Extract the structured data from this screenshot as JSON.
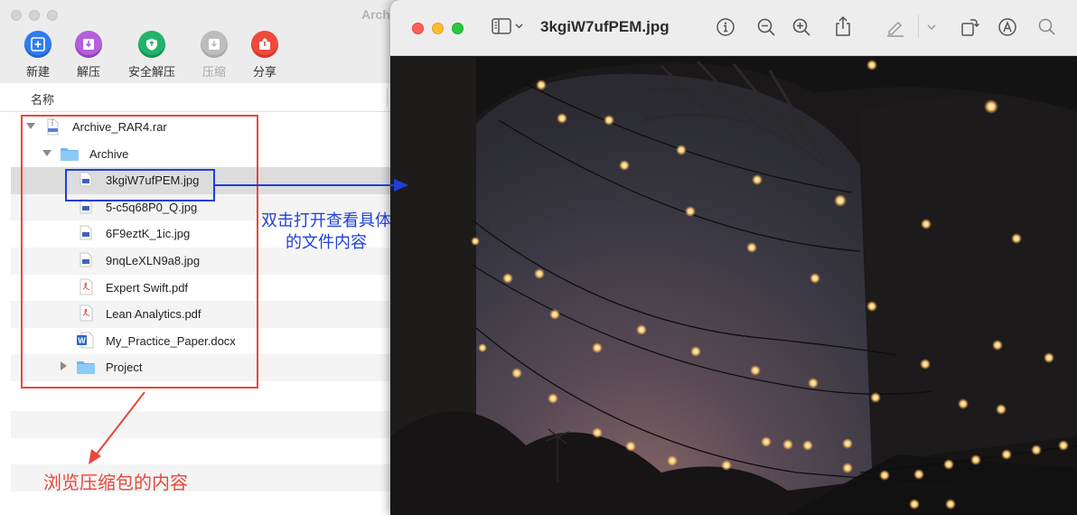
{
  "archiver": {
    "title": "Archiver",
    "toolbar": [
      {
        "id": "new",
        "label": "新建"
      },
      {
        "id": "extract",
        "label": "解压"
      },
      {
        "id": "safe_extract",
        "label": "安全解压"
      },
      {
        "id": "compress",
        "label": "压缩"
      },
      {
        "id": "share",
        "label": "分享"
      }
    ],
    "column_header": "名称",
    "tree": [
      {
        "name": "Archive_RAR4.rar",
        "type": "rar",
        "expanded": true
      },
      {
        "name": "Archive",
        "type": "folder",
        "expanded": true
      },
      {
        "name": "3kgiW7ufPEM.jpg",
        "type": "jpg",
        "selected": true
      },
      {
        "name": "5-c5q68P0_Q.jpg",
        "type": "jpg"
      },
      {
        "name": "6F9eztK_1ic.jpg",
        "type": "jpg"
      },
      {
        "name": "9nqLeXLN9a8.jpg",
        "type": "jpg"
      },
      {
        "name": "Expert Swift.pdf",
        "type": "pdf"
      },
      {
        "name": "Lean Analytics.pdf",
        "type": "pdf"
      },
      {
        "name": "My_Practice_Paper.docx",
        "type": "docx"
      },
      {
        "name": "Project",
        "type": "folder",
        "expanded": false
      }
    ]
  },
  "preview": {
    "title": "3kgiW7ufPEM.jpg",
    "image_description_icon": "photo-string-lights"
  },
  "annotations": {
    "blue_note_line1": "双击打开查看具体",
    "blue_note_line2": "的文件内容",
    "red_note": "浏览压缩包的内容",
    "red_color": "#e8473a",
    "blue_color": "#1f3fd8"
  }
}
